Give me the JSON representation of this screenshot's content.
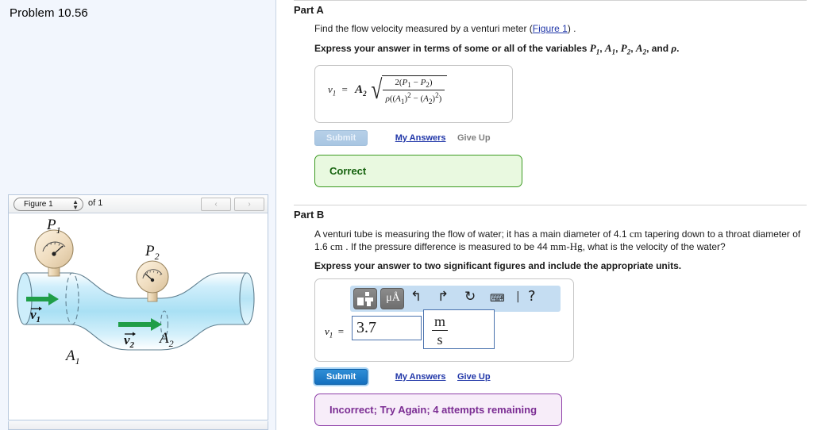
{
  "left": {
    "problem_title": "Problem 10.56",
    "figure": {
      "select_value": "Figure 1",
      "of_label": "of 1",
      "prev_icon": "‹",
      "next_icon": "›",
      "diagram_labels": {
        "p1": "P",
        "p1_sub": "1",
        "p2": "P",
        "p2_sub": "2",
        "v1": "v",
        "v1_sub": "1",
        "v2": "v",
        "v2_sub": "2",
        "a1": "A",
        "a1_sub": "1",
        "a2": "A",
        "a2_sub": "2"
      }
    }
  },
  "partA": {
    "heading": "Part A",
    "question_pre": "Find the flow velocity measured by a venturi meter (",
    "question_link": "Figure 1",
    "question_post": ") .",
    "instruction_pre": "Express your answer in terms of some or all of the variables ",
    "instruction_vars": [
      "P",
      "A",
      "P",
      "A"
    ],
    "instruction_subs": [
      "1",
      "1",
      "2",
      "2"
    ],
    "instruction_post": ", and ",
    "instruction_rho": "ρ",
    "instruction_end": ".",
    "formula": {
      "lhs": "v",
      "lhs_sub": "1",
      "eq": "=",
      "coef": "A",
      "coef_sub": "2",
      "numerator": "2(P₁ − P₂)",
      "denominator": "ρ((A₁)² − (A₂)²)"
    },
    "submit_label": "Submit",
    "my_answers_label": "My Answers",
    "give_up_label": "Give Up",
    "feedback": "Correct"
  },
  "partB": {
    "heading": "Part B",
    "question": "A venturi tube is measuring the flow of water; it has a main diameter of 4.1 cm tapering down to a throat diameter of 1.6 cm . If the pressure difference is measured to be 44 mm-Hg, what is the velocity of the water?",
    "question_line1_a": "A venturi tube is measuring the flow of water; it has a main diameter of 4.1 ",
    "question_unit_cm1": "cm",
    "question_line1_b": " tapering down to a throat diameter of",
    "question_line2_a": "1.6 ",
    "question_unit_cm2": "cm",
    "question_line2_b": " . If the pressure difference is measured to be 44 ",
    "question_unit_mmhg": "mm-Hg",
    "question_line2_c": ", what is the velocity of the water?",
    "instruction": "Express your answer to two significant figures and include the appropriate units.",
    "toolbar": {
      "template_icon": "template-blocks-icon",
      "units_label": "μÅ",
      "undo_icon": "↰",
      "redo_icon": "↱",
      "reset_icon": "↻",
      "keyboard_icon": "⌨",
      "separator": "|",
      "help_icon": "?"
    },
    "var_label": "v",
    "var_sub": "1",
    "equals": "=",
    "answer_value": "3.7",
    "unit_numerator": "m",
    "unit_denominator": "s",
    "submit_label": "Submit",
    "my_answers_label": "My Answers",
    "give_up_label": "Give Up",
    "feedback": "Incorrect; Try Again; 4 attempts remaining"
  },
  "colors": {
    "panel_bg": "#f2f6fd",
    "correct_green": "#14610d",
    "incorrect_purple": "#7b2d93",
    "link_blue": "#2036a8",
    "submit_blue": "#1470bf",
    "toolbar_blue": "#c5ddf2",
    "pipe_blue": "#bfe6f5",
    "arrow_green": "#1f9e48",
    "gauge_tan": "#f0ddc0"
  }
}
